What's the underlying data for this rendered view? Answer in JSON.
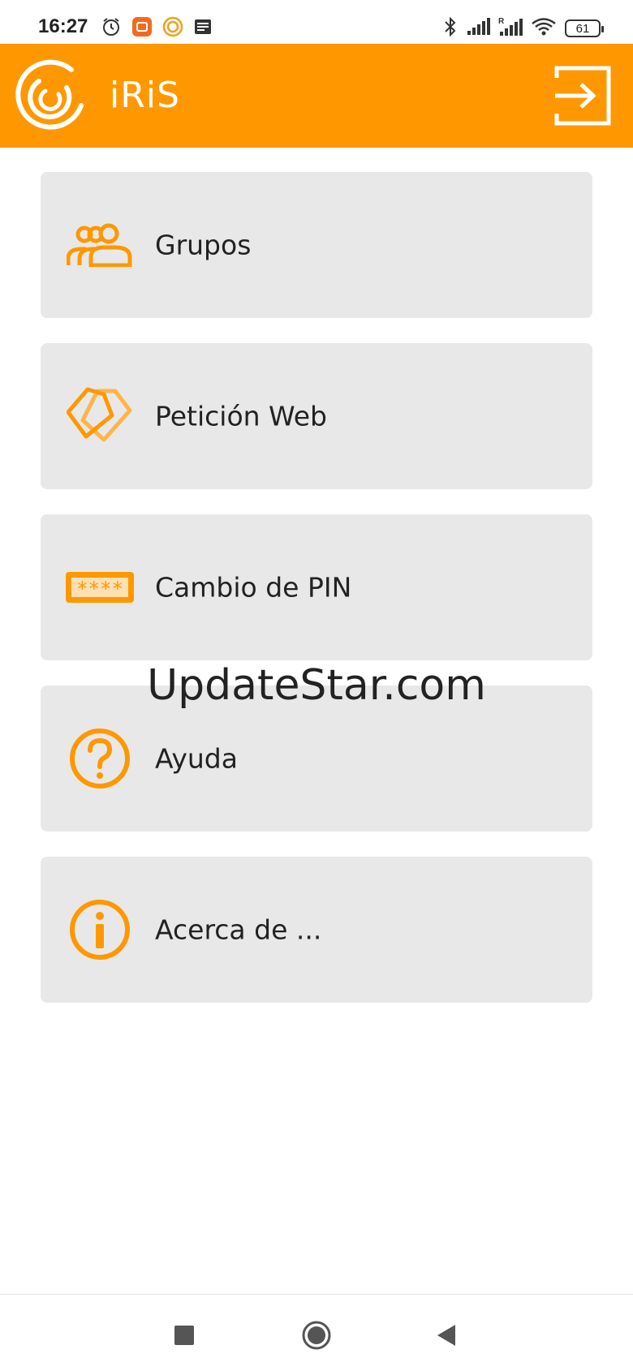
{
  "status_bar": {
    "time": "16:27",
    "battery": "61",
    "icons_left": [
      "alarm-icon",
      "mi-app-icon",
      "iris-notification-icon",
      "news-icon"
    ],
    "icons_right": [
      "bluetooth-icon",
      "signal-icon",
      "signal-roaming-icon",
      "wifi-icon",
      "battery-icon"
    ]
  },
  "app_bar": {
    "title": "iRiS",
    "logout_icon": "logout-icon",
    "color": "#ff9800"
  },
  "menu": {
    "items": [
      {
        "label": "Grupos",
        "icon": "groups-icon"
      },
      {
        "label": "Petición Web",
        "icon": "tags-icon"
      },
      {
        "label": "Cambio de PIN",
        "icon": "pin-icon"
      },
      {
        "label": "Ayuda",
        "icon": "help-icon"
      },
      {
        "label": "Acerca de ...",
        "icon": "info-icon"
      }
    ]
  },
  "watermark": "UpdateStar.com",
  "nav_bar": {
    "buttons": [
      "recents-button",
      "home-button",
      "back-button"
    ]
  },
  "colors": {
    "accent": "#ff9800",
    "card_background": "#e8e8e8"
  }
}
